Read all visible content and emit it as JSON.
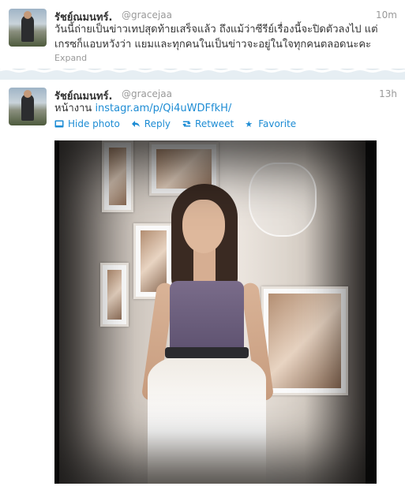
{
  "tweets": [
    {
      "name": "รัชย์ณมนทร์.",
      "handle": "@gracejaa",
      "time": "10m",
      "text_line1": "วันนี้ถ่ายเป็นข่าวเทปสุดท้ายเสร็จแล้ว ถึงแม้ว่าซีรีย์เรื่องนี้จะปิดตัวลงไป แต่",
      "text_line2": "เกรซก็แอบหวังว่า แยมและทุกคนในเป็นข่าวจะอยู่ในใจทุกคนตลอดนะคะ",
      "expand": "Expand"
    },
    {
      "name": "รัชย์ณมนทร์.",
      "handle": "@gracejaa",
      "time": "13h",
      "text_prefix": "หน้างาน ",
      "link": "instagr.am/p/Qi4uWDFfkH/",
      "actions": {
        "hide_photo": "Hide photo",
        "reply": "Reply",
        "retweet": "Retweet",
        "favorite": "Favorite"
      }
    }
  ],
  "colors": {
    "link": "#1d8cd4",
    "meta": "#999999",
    "text": "#333333"
  }
}
